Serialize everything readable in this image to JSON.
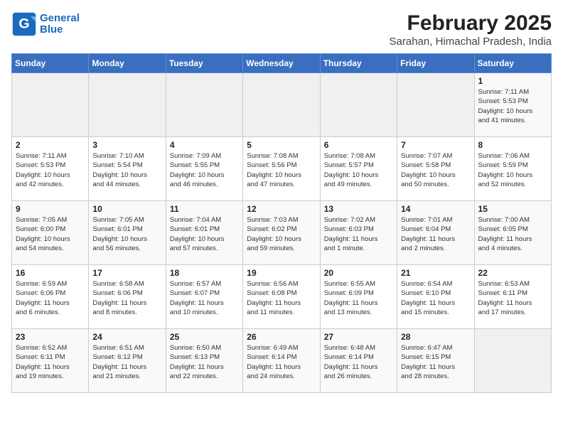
{
  "header": {
    "logo_line1": "General",
    "logo_line2": "Blue",
    "title": "February 2025",
    "subtitle": "Sarahan, Himachal Pradesh, India"
  },
  "days_of_week": [
    "Sunday",
    "Monday",
    "Tuesday",
    "Wednesday",
    "Thursday",
    "Friday",
    "Saturday"
  ],
  "weeks": [
    [
      {
        "day": "",
        "info": ""
      },
      {
        "day": "",
        "info": ""
      },
      {
        "day": "",
        "info": ""
      },
      {
        "day": "",
        "info": ""
      },
      {
        "day": "",
        "info": ""
      },
      {
        "day": "",
        "info": ""
      },
      {
        "day": "1",
        "info": "Sunrise: 7:11 AM\nSunset: 5:53 PM\nDaylight: 10 hours\nand 41 minutes."
      }
    ],
    [
      {
        "day": "2",
        "info": "Sunrise: 7:11 AM\nSunset: 5:53 PM\nDaylight: 10 hours\nand 42 minutes."
      },
      {
        "day": "3",
        "info": "Sunrise: 7:10 AM\nSunset: 5:54 PM\nDaylight: 10 hours\nand 44 minutes."
      },
      {
        "day": "4",
        "info": "Sunrise: 7:09 AM\nSunset: 5:55 PM\nDaylight: 10 hours\nand 46 minutes."
      },
      {
        "day": "5",
        "info": "Sunrise: 7:08 AM\nSunset: 5:56 PM\nDaylight: 10 hours\nand 47 minutes."
      },
      {
        "day": "6",
        "info": "Sunrise: 7:08 AM\nSunset: 5:57 PM\nDaylight: 10 hours\nand 49 minutes."
      },
      {
        "day": "7",
        "info": "Sunrise: 7:07 AM\nSunset: 5:58 PM\nDaylight: 10 hours\nand 50 minutes."
      },
      {
        "day": "8",
        "info": "Sunrise: 7:06 AM\nSunset: 5:59 PM\nDaylight: 10 hours\nand 52 minutes."
      }
    ],
    [
      {
        "day": "9",
        "info": "Sunrise: 7:05 AM\nSunset: 6:00 PM\nDaylight: 10 hours\nand 54 minutes."
      },
      {
        "day": "10",
        "info": "Sunrise: 7:05 AM\nSunset: 6:01 PM\nDaylight: 10 hours\nand 56 minutes."
      },
      {
        "day": "11",
        "info": "Sunrise: 7:04 AM\nSunset: 6:01 PM\nDaylight: 10 hours\nand 57 minutes."
      },
      {
        "day": "12",
        "info": "Sunrise: 7:03 AM\nSunset: 6:02 PM\nDaylight: 10 hours\nand 59 minutes."
      },
      {
        "day": "13",
        "info": "Sunrise: 7:02 AM\nSunset: 6:03 PM\nDaylight: 11 hours\nand 1 minute."
      },
      {
        "day": "14",
        "info": "Sunrise: 7:01 AM\nSunset: 6:04 PM\nDaylight: 11 hours\nand 2 minutes."
      },
      {
        "day": "15",
        "info": "Sunrise: 7:00 AM\nSunset: 6:05 PM\nDaylight: 11 hours\nand 4 minutes."
      }
    ],
    [
      {
        "day": "16",
        "info": "Sunrise: 6:59 AM\nSunset: 6:06 PM\nDaylight: 11 hours\nand 6 minutes."
      },
      {
        "day": "17",
        "info": "Sunrise: 6:58 AM\nSunset: 6:06 PM\nDaylight: 11 hours\nand 8 minutes."
      },
      {
        "day": "18",
        "info": "Sunrise: 6:57 AM\nSunset: 6:07 PM\nDaylight: 11 hours\nand 10 minutes."
      },
      {
        "day": "19",
        "info": "Sunrise: 6:56 AM\nSunset: 6:08 PM\nDaylight: 11 hours\nand 11 minutes."
      },
      {
        "day": "20",
        "info": "Sunrise: 6:55 AM\nSunset: 6:09 PM\nDaylight: 11 hours\nand 13 minutes."
      },
      {
        "day": "21",
        "info": "Sunrise: 6:54 AM\nSunset: 6:10 PM\nDaylight: 11 hours\nand 15 minutes."
      },
      {
        "day": "22",
        "info": "Sunrise: 6:53 AM\nSunset: 6:11 PM\nDaylight: 11 hours\nand 17 minutes."
      }
    ],
    [
      {
        "day": "23",
        "info": "Sunrise: 6:52 AM\nSunset: 6:11 PM\nDaylight: 11 hours\nand 19 minutes."
      },
      {
        "day": "24",
        "info": "Sunrise: 6:51 AM\nSunset: 6:12 PM\nDaylight: 11 hours\nand 21 minutes."
      },
      {
        "day": "25",
        "info": "Sunrise: 6:50 AM\nSunset: 6:13 PM\nDaylight: 11 hours\nand 22 minutes."
      },
      {
        "day": "26",
        "info": "Sunrise: 6:49 AM\nSunset: 6:14 PM\nDaylight: 11 hours\nand 24 minutes."
      },
      {
        "day": "27",
        "info": "Sunrise: 6:48 AM\nSunset: 6:14 PM\nDaylight: 11 hours\nand 26 minutes."
      },
      {
        "day": "28",
        "info": "Sunrise: 6:47 AM\nSunset: 6:15 PM\nDaylight: 11 hours\nand 28 minutes."
      },
      {
        "day": "",
        "info": ""
      }
    ]
  ]
}
